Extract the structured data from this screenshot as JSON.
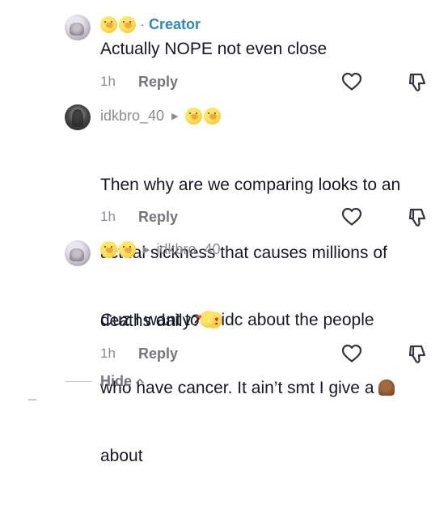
{
  "comments": [
    {
      "avatar_icon": "profile-avatar",
      "username": "",
      "badges": [
        "emoji-face",
        "emoji-face"
      ],
      "separator": "·",
      "tag": "Creator",
      "text": "Actually NOPE not even close",
      "time": "1h",
      "reply_label": "Reply"
    },
    {
      "avatar_icon": "profile-avatar",
      "username": "idkbro_40",
      "reply_arrow": "▶",
      "badges": [
        "emoji-face",
        "emoji-face"
      ],
      "text_lines": [
        "Then why are we comparing looks to an",
        "actual sickness that causes millions of",
        "deaths daily?"
      ],
      "time": "1h",
      "reply_label": "Reply"
    },
    {
      "avatar_icon": "profile-avatar",
      "badges": [
        "emoji-face",
        "emoji-face"
      ],
      "reply_arrow": "▶",
      "reply_to": "idkbro_40",
      "text_part1": "Cuz I want to",
      "text_part2": " idc about the people",
      "text_line2": "who have cancer. It ain’t smt I give a ",
      "text_line3": "about",
      "time": "1h",
      "reply_label": "Reply"
    }
  ],
  "hide": {
    "label": "Hide",
    "icon": "chevron-up-icon"
  },
  "colors": {
    "creator": "#2f86b3",
    "muted": "#8a8b91",
    "text": "#161823"
  }
}
